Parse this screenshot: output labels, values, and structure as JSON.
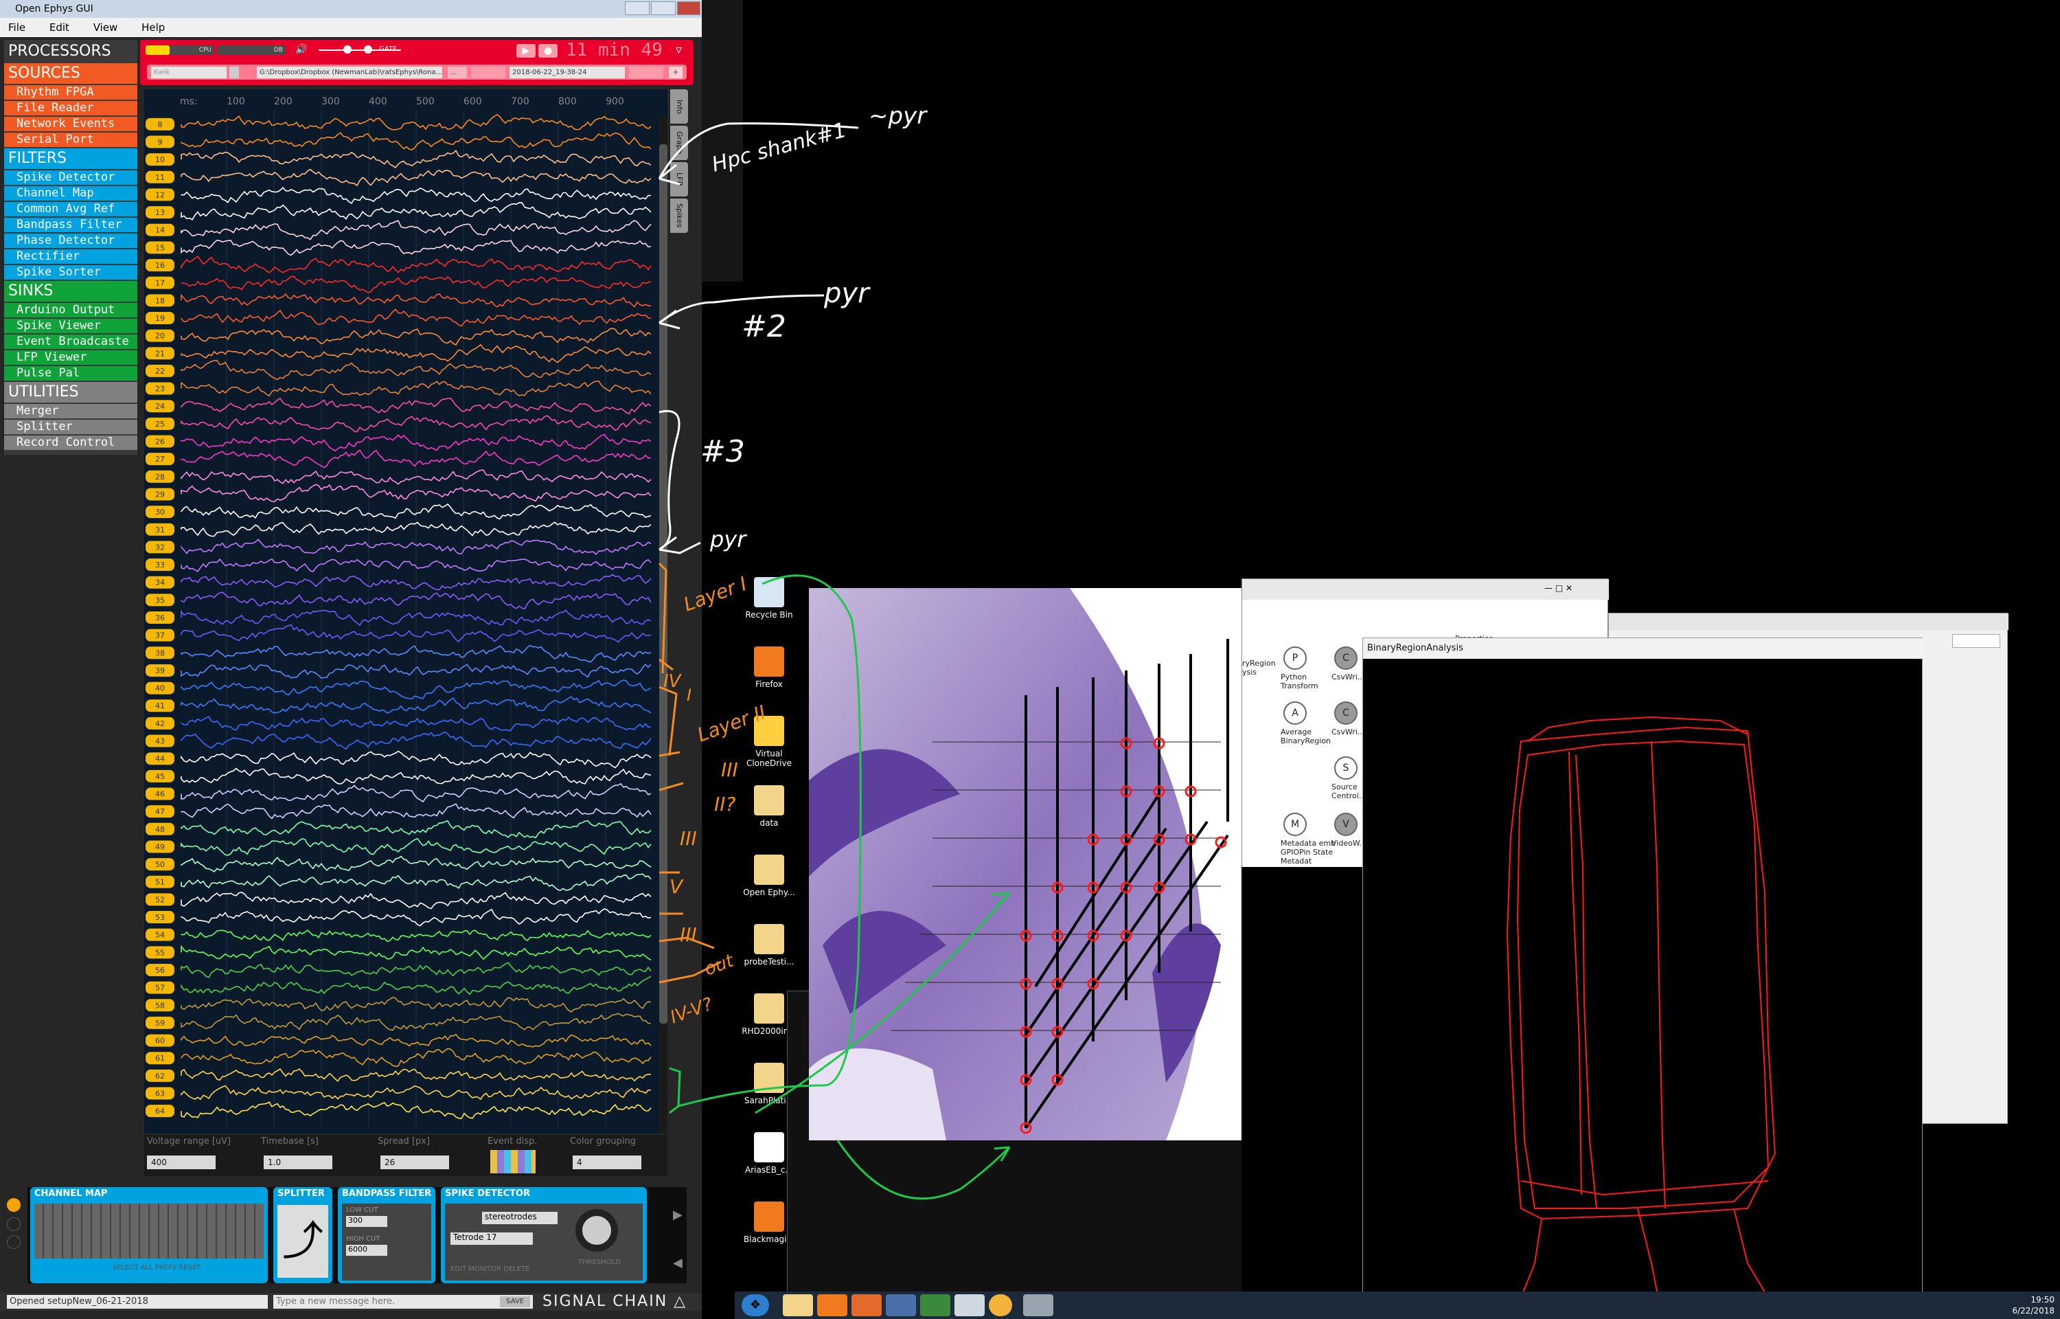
{
  "oe": {
    "title": "Open Ephys GUI",
    "menu": [
      "File",
      "Edit",
      "View",
      "Help"
    ],
    "categories": [
      {
        "name": "PROCESSORS",
        "color": "#3a3a3a",
        "items": []
      },
      {
        "name": "SOURCES",
        "color": "#f15a22",
        "items": [
          "Rhythm FPGA",
          "File Reader",
          "Network Events",
          "Serial Port"
        ]
      },
      {
        "name": "FILTERS",
        "color": "#00a3e0",
        "items": [
          "Spike Detector",
          "Channel Map",
          "Common Avg Ref",
          "Bandpass Filter",
          "Phase Detector",
          "Rectifier",
          "Spike Sorter"
        ]
      },
      {
        "name": "SINKS",
        "color": "#0fa33a",
        "items": [
          "Arduino Output",
          "Spike Viewer",
          "Event Broadcaste",
          "LFP Viewer",
          "Pulse Pal"
        ]
      },
      {
        "name": "UTILITIES",
        "color": "#808080",
        "items": [
          "Merger",
          "Splitter",
          "Record Control"
        ]
      }
    ],
    "control": {
      "cpu_label": "CPU",
      "cpu_fraction": 0.35,
      "db_label": "DB",
      "gate_label": "GATE",
      "clock": "11 min 49",
      "engine": "Kwik",
      "path": "G:\\Dropbox\\Dropbox (NewmanLab)\\ratsEphys\\Rona...",
      "dots": "...",
      "datetime": "2018-06-22_19-38-24"
    },
    "lfp": {
      "ms_label": "ms:",
      "ticks": [
        "100",
        "200",
        "300",
        "400",
        "500",
        "600",
        "700",
        "800",
        "900"
      ],
      "channels": [
        "8",
        "9",
        "10",
        "11",
        "12",
        "13",
        "14",
        "15",
        "16",
        "17",
        "18",
        "19",
        "20",
        "21",
        "22",
        "23",
        "24",
        "25",
        "26",
        "27",
        "28",
        "29",
        "30",
        "31",
        "32",
        "33",
        "34",
        "35",
        "36",
        "37",
        "38",
        "39",
        "40",
        "41",
        "42",
        "43",
        "44",
        "45",
        "46",
        "47",
        "48",
        "49",
        "50",
        "51",
        "52",
        "53",
        "54",
        "55",
        "56",
        "57",
        "58",
        "59",
        "60",
        "61",
        "62",
        "63",
        "64"
      ],
      "tabs": [
        "Info",
        "Graph",
        "LFP",
        "Spikes"
      ]
    },
    "bottom": {
      "voltage_label": "Voltage range [uV]",
      "voltage_value": "400",
      "timebase_label": "Timebase [s]",
      "timebase_value": "1.0",
      "spread_label": "Spread [px]",
      "spread_value": "26",
      "event_label": "Event disp.",
      "color_label": "Color grouping",
      "color_value": "4"
    },
    "graph": {
      "channel_map": "CHANNEL MAP",
      "splitter": "SPLITTER",
      "bandpass": "BANDPASS FILTER",
      "low_cut_label": "LOW CUT",
      "low_cut": "300",
      "high_cut_label": "HIGH CUT",
      "high_cut": "6000",
      "spike": "SPIKE DETECTOR",
      "spike_type": "stereotrodes",
      "electrode": "Tetrode 17",
      "threshold": "THRESHOLD",
      "cm_actions": "SELECT ALL  PREFS  RESET",
      "sd_actions": "EDIT  MONITOR  DELETE"
    },
    "status": {
      "message": "Opened setupNew_06-21-2018",
      "placeholder": "Type a new message here.",
      "save": "SAVE",
      "signal_chain": "SIGNAL CHAIN"
    }
  },
  "desktop": {
    "icons": [
      {
        "label": "Recycle Bin",
        "color": "#d8e6f4"
      },
      {
        "label": "Firefox",
        "color": "#f27a1e"
      },
      {
        "label": "Virtual CloneDrive",
        "color": "#ffcf3f"
      },
      {
        "label": "data",
        "color": "#f2d58a"
      },
      {
        "label": "Open Ephy...",
        "color": "#f2d58a"
      },
      {
        "label": "probeTesti...",
        "color": "#f2d58a"
      },
      {
        "label": "RHD2000in...",
        "color": "#f2d58a"
      },
      {
        "label": "SarahPlati...",
        "color": "#f2d58a"
      },
      {
        "label": "AriasEB_c...",
        "color": "#ffffff"
      },
      {
        "label": "Blackmagi...",
        "color": "#f27a1e"
      }
    ]
  },
  "bonsai": {
    "nodes": [
      {
        "letter": "P",
        "label": "Python Transform"
      },
      {
        "letter": "C",
        "label": "CsvWri..."
      },
      {
        "letter": "A",
        "label": "Average BinaryRegion"
      },
      {
        "letter": "C",
        "label": "CsvWri..."
      },
      {
        "letter": "S",
        "label": "Source Centroi..."
      },
      {
        "letter": "M",
        "label": "Metadata emb GPIOPin State Metadat"
      },
      {
        "letter": "V",
        "label": "VideoW..."
      }
    ],
    "left_label": "ryRegion ysis",
    "properties": "Properties"
  },
  "binary_region": {
    "title": "BinaryRegionAnalysis"
  },
  "taskbar": {
    "time": "19:50",
    "date": "6/22/2018"
  },
  "annotations": {
    "pyr1": "~pyr",
    "hpc": "Hpc shank#1",
    "n2": "#2",
    "pyr2": "pyr",
    "n3": "#3",
    "pyr3": "pyr",
    "layer1": "Layer I",
    "iv": "IV",
    "i": "I",
    "layer2": "Layer II",
    "iii": "III",
    "ii2": "II?",
    "iii2": "III",
    "v": "V",
    "iii3": "III",
    "out": "out",
    "ivv": "IV-V?"
  }
}
